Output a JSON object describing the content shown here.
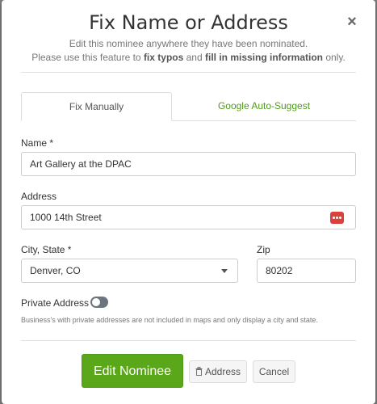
{
  "modal": {
    "title": "Fix Name or Address",
    "close_symbol": "×",
    "subtitle_line1": "Edit this nominee anywhere they have been nominated.",
    "subtitle_line2_a": "Please use this feature to ",
    "subtitle_line2_b": "fix typos",
    "subtitle_line2_c": " and ",
    "subtitle_line2_d": "fill in missing information",
    "subtitle_line2_e": " only."
  },
  "tabs": [
    {
      "label": "Fix Manually",
      "active": true
    },
    {
      "label": "Google Auto-Suggest",
      "active": false
    }
  ],
  "form": {
    "name_label": "Name *",
    "name_value": "Art Gallery at the DPAC",
    "address_label": "Address",
    "address_value": "1000 14th Street",
    "city_label": "City, State *",
    "city_value": "Denver, CO",
    "zip_label": "Zip",
    "zip_value": "80202",
    "private_label": "Private Address",
    "private_on": false,
    "private_help": "Business's with private addresses are not included in maps and only display a city and state."
  },
  "buttons": {
    "edit": "Edit Nominee",
    "address": "Address",
    "cancel": "Cancel"
  },
  "colors": {
    "accent_green": "#5ba71a",
    "tab_link_green": "#4f9a1a",
    "dots_icon_red": "#d9413a",
    "toggle_off": "#6c757d"
  },
  "icons": [
    "close-icon",
    "more-dots-icon",
    "dropdown-caret-icon",
    "trash-icon"
  ]
}
